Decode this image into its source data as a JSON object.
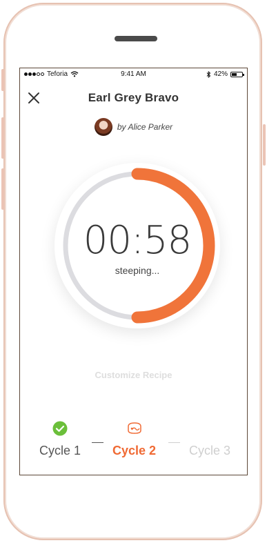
{
  "status_bar": {
    "carrier": "Teforia",
    "time": "9:41 AM",
    "battery": "42%",
    "battery_level": 0.42
  },
  "header": {
    "close_icon": "close-icon",
    "title": "Earl Grey Bravo"
  },
  "author": {
    "by_line": "by Alice Parker"
  },
  "timer": {
    "time": "00:58",
    "status": "steeping...",
    "progress": 0.5,
    "progress_color": "#f0743a",
    "track_color": "#dcdce0"
  },
  "customize_label": "Customize Recipe",
  "cycles": [
    {
      "label": "Cycle 1",
      "state": "complete",
      "icon": "check-circle-icon"
    },
    {
      "label": "Cycle 2",
      "state": "active",
      "icon": "teapot-icon"
    },
    {
      "label": "Cycle 3",
      "state": "pending"
    }
  ],
  "colors": {
    "accent": "#f06a34",
    "complete": "#6bbf3a"
  }
}
